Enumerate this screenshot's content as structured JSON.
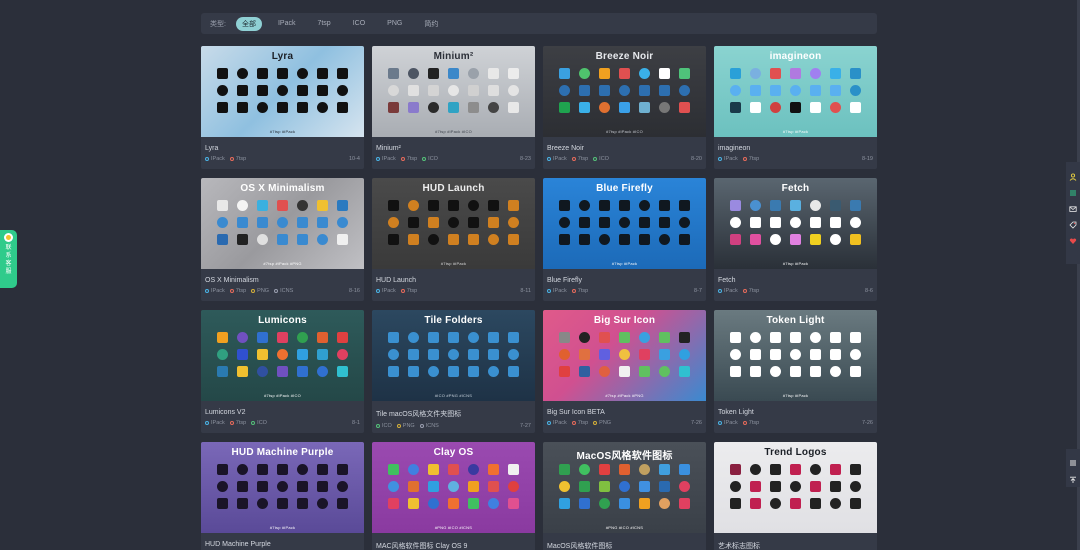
{
  "filter": {
    "label": "类型:",
    "options": [
      "全部",
      "IPack",
      "7tsp",
      "ICO",
      "PNG",
      "简约"
    ],
    "active_index": 0
  },
  "contact": {
    "label": "联系客服"
  },
  "cards": [
    {
      "thumb_title": "Lyra",
      "name": "Lyra",
      "tags": [
        "IPack",
        "7tsp"
      ],
      "date": "10-4",
      "thumb_tags": "#7tsp #iPack",
      "bg": "linear-gradient(135deg,#c8dbe9 0%,#8fc0e0 50%,#d6e4ef 100%)",
      "title_color": "#1b1f26",
      "tags_color": "#1b1f26",
      "icons": [
        "#111",
        "#111",
        "#111",
        "#111",
        "#111",
        "#111",
        "#111",
        "#111",
        "#111",
        "#111",
        "#111",
        "#111",
        "#111",
        "#111",
        "#111",
        "#111",
        "#111",
        "#111",
        "#111",
        "#111",
        "#111"
      ]
    },
    {
      "thumb_title": "Minium²",
      "name": "Minium²",
      "tags": [
        "IPack",
        "7tsp",
        "ICO"
      ],
      "date": "8-23",
      "thumb_tags": "#7tsp #iPack #ICO",
      "bg": "linear-gradient(180deg,#cfd2d6 0%,#a9adb3 100%)",
      "title_color": "#2b2f38",
      "tags_color": "#3a3f48",
      "icons": [
        "#6b7a8c",
        "#4d5563",
        "#222",
        "#3c88c9",
        "#9aa1aa",
        "#e8e8e8",
        "#ececec",
        "#d8d8d8",
        "#e0e0e0",
        "#d4d4d4",
        "#e6e6e6",
        "#d0d0d0",
        "#dedede",
        "#e4e4e4",
        "#7a3a3a",
        "#8a7acc",
        "#2a2a2a",
        "#30a3c4",
        "#8d8d8d",
        "#444",
        "#e8e8e8"
      ]
    },
    {
      "thumb_title": "Breeze Noir",
      "name": "Breeze Noir",
      "tags": [
        "IPack",
        "7tsp",
        "ICO"
      ],
      "date": "8-20",
      "thumb_tags": "#7tsp #iPack #ICO",
      "bg": "linear-gradient(180deg,#3d3f44 0%,#2c2e33 100%)",
      "title_color": "#e6e8ec",
      "tags_color": "#c9ccd3",
      "icons": [
        "#3aa0e0",
        "#4fc36d",
        "#f0a020",
        "#e05050",
        "#3ab0e8",
        "#ffffff",
        "#4fc37a",
        "#2d6fb0",
        "#2d6fb0",
        "#2d6fb0",
        "#2d6fb0",
        "#2d6fb0",
        "#2d6fb0",
        "#2d6fb0",
        "#1fa34f",
        "#3ab0e8",
        "#e07030",
        "#3aa0e8",
        "#6fb0d0",
        "#777",
        "#e05050"
      ]
    },
    {
      "thumb_title": "imagineon",
      "name": "imagineon",
      "tags": [
        "IPack",
        "7tsp"
      ],
      "date": "8-19",
      "thumb_tags": "#7tsp #iPack",
      "bg": "linear-gradient(180deg,#8ad3d0 0%,#6cc1bf 100%)",
      "title_color": "#ffffff",
      "tags_color": "#ffffff",
      "icons": [
        "#2aa0d8",
        "#7ab0e0",
        "#e05050",
        "#b07ae0",
        "#a080f0",
        "#3ab0e8",
        "#2a90c8",
        "#5ab0f0",
        "#5ab0f0",
        "#5ab0f0",
        "#5ab0f0",
        "#5ab0f0",
        "#5ab0f0",
        "#2a90c8",
        "#1a3a4a",
        "#ffffff",
        "#d04040",
        "#111",
        "#ffffff",
        "#e05050",
        "#ffffff"
      ]
    },
    {
      "thumb_title": "OS X Minimalism",
      "name": "OS X Minimalism",
      "tags": [
        "IPack",
        "7tsp",
        "PNG",
        "ICNS"
      ],
      "date": "8-16",
      "thumb_tags": "#7tsp #iPack #PNG",
      "bg": "linear-gradient(135deg,#b8b8bc 0%,#9a9a9e 50%,#c0c0c4 100%)",
      "title_color": "#ffffff",
      "tags_color": "#ffffff",
      "icons": [
        "#e8e8e8",
        "#f4f4f4",
        "#3ab0e0",
        "#e05050",
        "#333",
        "#f0c030",
        "#2a7ac0",
        "#3a8ad0",
        "#3a8ad0",
        "#3a8ad0",
        "#3a8ad0",
        "#3a8ad0",
        "#3a8ad0",
        "#3a8ad0",
        "#2a6ab0",
        "#222",
        "#e0e0e0",
        "#3a8ad0",
        "#3a8ad0",
        "#3a8ad0",
        "#f0f0f0"
      ]
    },
    {
      "thumb_title": "HUD Launch",
      "name": "HUD Launch",
      "tags": [
        "IPack",
        "7tsp"
      ],
      "date": "8-11",
      "thumb_tags": "#7tsp #iPack",
      "bg": "linear-gradient(180deg,#4a4a4a 0%,#3a3a3a 100%)",
      "title_color": "#eeeeee",
      "tags_color": "#dddddd",
      "icons": [
        "#111",
        "#d08020",
        "#111",
        "#111",
        "#111",
        "#111",
        "#d08020",
        "#d08020",
        "#111",
        "#d08020",
        "#111",
        "#111",
        "#d08020",
        "#d08020",
        "#111",
        "#d08020",
        "#111",
        "#d08020",
        "#d08020",
        "#d08020",
        "#d08020"
      ]
    },
    {
      "thumb_title": "Blue Firefly",
      "name": "Blue Firefly",
      "tags": [
        "IPack",
        "7tsp"
      ],
      "date": "8-7",
      "thumb_tags": "#7tsp #iPack",
      "bg": "linear-gradient(180deg,#2a84d8 0%,#1c6ab8 100%)",
      "title_color": "#ffffff",
      "tags_color": "#ffffff",
      "icons": [
        "#101820",
        "#101820",
        "#101820",
        "#101820",
        "#101820",
        "#101820",
        "#101820",
        "#101820",
        "#101820",
        "#101820",
        "#101820",
        "#101820",
        "#101820",
        "#101820",
        "#101820",
        "#101820",
        "#101820",
        "#101820",
        "#101820",
        "#101820",
        "#101820"
      ]
    },
    {
      "thumb_title": "Fetch",
      "name": "Fetch",
      "tags": [
        "IPack",
        "7tsp"
      ],
      "date": "8-6",
      "thumb_tags": "#7tsp #iPack",
      "bg": "linear-gradient(180deg,#5a6670 0%,#2a3038 100%)",
      "title_color": "#ffffff",
      "tags_color": "#ffffff",
      "icons": [
        "#9a8ae0",
        "#4a90d0",
        "#3a7ab0",
        "#5ab0e0",
        "#e8e8e8",
        "#3a5a70",
        "#3a7ab0",
        "#ffffff",
        "#ffffff",
        "#ffffff",
        "#ffffff",
        "#ffffff",
        "#ffffff",
        "#ffffff",
        "#d04080",
        "#e050a0",
        "#ffffff",
        "#e080e0",
        "#f0d020",
        "#ffffff",
        "#f0c020"
      ]
    },
    {
      "thumb_title": "Lumicons",
      "name": "Lumicons V2",
      "tags": [
        "IPack",
        "7tsp",
        "ICO"
      ],
      "date": "8-1",
      "thumb_tags": "#7tsp #iPack #ICO",
      "bg": "linear-gradient(180deg,#2e5a5a 0%,#244848 100%)",
      "title_color": "#ffffff",
      "tags_color": "#ffffff",
      "icons": [
        "#f0a020",
        "#7050c0",
        "#3070d0",
        "#e04060",
        "#30a050",
        "#e06030",
        "#e04040",
        "#30a080",
        "#3050d0",
        "#f0c030",
        "#f07030",
        "#30a0e0",
        "#30a0d0",
        "#e04060",
        "#2a7ab0",
        "#f0c030",
        "#3050a0",
        "#7050c0",
        "#3070d0",
        "#3070d0",
        "#30c0d0"
      ]
    },
    {
      "thumb_title": "Tile Folders",
      "name": "Tile macOS风格文件夹图标",
      "tags": [
        "ICO",
        "PNG",
        "ICNS"
      ],
      "date": "7-27",
      "thumb_tags": "#ICO #PNG #ICNS",
      "bg": "linear-gradient(180deg,#2c4860 0%,#1e3246 100%)",
      "title_color": "#ffffff",
      "tags_color": "#c9d4de",
      "icons": [
        "#3a90d0",
        "#3a90d0",
        "#3a90d0",
        "#3a90d0",
        "#3a90d0",
        "#3a90d0",
        "#3a90d0",
        "#3a90d0",
        "#3a90d0",
        "#3a90d0",
        "#3a90d0",
        "#3a90d0",
        "#3a90d0",
        "#3a90d0",
        "#3a90d0",
        "#3a90d0",
        "#3a90d0",
        "#3a90d0",
        "#3a90d0",
        "#3a90d0",
        "#3a90d0"
      ]
    },
    {
      "thumb_title": "Big Sur Icon",
      "name": "Big Sur Icon BETA",
      "tags": [
        "IPack",
        "7tsp",
        "PNG"
      ],
      "date": "7-26",
      "thumb_tags": "#7tsp #iPack #PNG",
      "bg": "linear-gradient(135deg,#e05a8a 0%,#d05090 40%,#3a8ad0 100%)",
      "title_color": "#ffffff",
      "tags_color": "#ffffff",
      "icons": [
        "#888",
        "#222",
        "#e05050",
        "#60c060",
        "#3aa0e0",
        "#60c060",
        "#222",
        "#e06030",
        "#e07040",
        "#6060e0",
        "#f0c040",
        "#e04060",
        "#3aa0e0",
        "#30a0e0",
        "#e04040",
        "#3060a0",
        "#e06040",
        "#f0f0f0",
        "#60c060",
        "#60c060",
        "#30c0d0"
      ]
    },
    {
      "thumb_title": "Token Light",
      "name": "Token Light",
      "tags": [
        "IPack",
        "7tsp"
      ],
      "date": "7-26",
      "thumb_tags": "#7tsp #iPack",
      "bg": "linear-gradient(180deg,#6a7a80 0%,#3a4a52 100%)",
      "title_color": "#ffffff",
      "tags_color": "#ffffff",
      "icons": [
        "#ffffff",
        "#ffffff",
        "#ffffff",
        "#ffffff",
        "#ffffff",
        "#ffffff",
        "#ffffff",
        "#ffffff",
        "#ffffff",
        "#ffffff",
        "#ffffff",
        "#ffffff",
        "#ffffff",
        "#ffffff",
        "#ffffff",
        "#ffffff",
        "#ffffff",
        "#ffffff",
        "#ffffff",
        "#ffffff",
        "#ffffff"
      ]
    },
    {
      "thumb_title": "HUD Machine Purple",
      "name": "HUD Machine Purple",
      "tags": [],
      "date": "",
      "thumb_tags": "#7tsp #iPack",
      "bg": "linear-gradient(180deg,#7a68b8 0%,#5a4a98 100%)",
      "title_color": "#ffffff",
      "tags_color": "#ffffff",
      "icons": [
        "#1a1428",
        "#1a1428",
        "#1a1428",
        "#1a1428",
        "#1a1428",
        "#1a1428",
        "#1a1428",
        "#1a1428",
        "#1a1428",
        "#1a1428",
        "#1a1428",
        "#1a1428",
        "#1a1428",
        "#1a1428",
        "#1a1428",
        "#1a1428",
        "#1a1428",
        "#1a1428",
        "#1a1428",
        "#1a1428",
        "#1a1428"
      ]
    },
    {
      "thumb_title": "Clay OS",
      "name": "MAC风格软件图标 Clay OS 9",
      "tags": [],
      "date": "",
      "thumb_tags": "#PNG #ICO #ICNS",
      "bg": "linear-gradient(180deg,#9a4ab0 0%,#8a3aa0 100%)",
      "title_color": "#ffffff",
      "tags_color": "#ffffff",
      "icons": [
        "#40c060",
        "#4080e0",
        "#f0c030",
        "#e05050",
        "#3a3aa0",
        "#f07030",
        "#f0f0f0",
        "#4090e0",
        "#e07030",
        "#30a0e0",
        "#60b0e0",
        "#f0a020",
        "#e05050",
        "#e04040",
        "#e04060",
        "#f0c030",
        "#3070d0",
        "#f07030",
        "#40c060",
        "#4080e0",
        "#e05090"
      ]
    },
    {
      "thumb_title": "MacOS风格软件图标",
      "name": "MacOS风格软件图标",
      "tags": [],
      "date": "",
      "thumb_tags": "#PNG #ICO #ICNS",
      "bg": "linear-gradient(180deg,#4a5058 0%,#3a4048 100%)",
      "title_color": "#ffffff",
      "tags_color": "#ffffff",
      "icons": [
        "#30a050",
        "#40c060",
        "#e04040",
        "#e06030",
        "#c0a060",
        "#40a0e0",
        "#3a90e0",
        "#f0c030",
        "#30a050",
        "#80c040",
        "#3070d0",
        "#4090e0",
        "#2a6ab0",
        "#e04060",
        "#30a0e0",
        "#3070d0",
        "#30a050",
        "#3a90e0",
        "#f0a020",
        "#e0a060",
        "#e04060"
      ]
    },
    {
      "thumb_title": "Trend Logos",
      "name": "艺术标志图标",
      "tags": [],
      "date": "",
      "thumb_tags": "",
      "bg": "linear-gradient(180deg,#ececee 0%,#e0e0e4 100%)",
      "title_color": "#1b1f26",
      "tags_color": "#1b1f26",
      "icons": [
        "#8a2040",
        "#222",
        "#222",
        "#c02050",
        "#222",
        "#c02050",
        "#222",
        "#222",
        "#c02050",
        "#222",
        "#222",
        "#c02050",
        "#222",
        "#222",
        "#222",
        "#c02050",
        "#222",
        "#c02050",
        "#222",
        "#222",
        "#222"
      ]
    }
  ]
}
